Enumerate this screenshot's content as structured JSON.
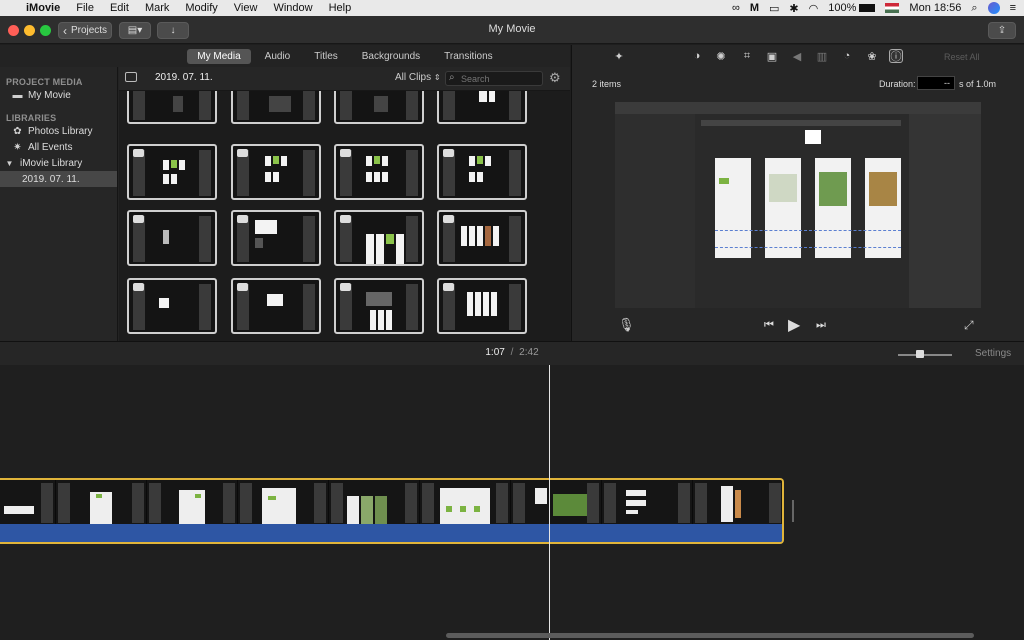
{
  "menubar": {
    "app_name": "iMovie",
    "items": [
      "File",
      "Edit",
      "Mark",
      "Modify",
      "View",
      "Window",
      "Help"
    ],
    "battery": "100%",
    "clock": "Mon 18:56"
  },
  "window": {
    "title": "My Movie",
    "projects_button": "Projects",
    "back_chevron": "‹",
    "close_color": "#ff5f57",
    "minimize_color": "#febc2e",
    "zoom_color": "#28c840"
  },
  "browser_tabs": {
    "tabs": [
      "My Media",
      "Audio",
      "Titles",
      "Backgrounds",
      "Transitions"
    ],
    "active": "My Media"
  },
  "sidebar": {
    "project_media_header": "PROJECT MEDIA",
    "my_movie": "My Movie",
    "libraries_header": "LIBRARIES",
    "photos_library": "Photos Library",
    "all_events": "All Events",
    "imovie_library": "iMovie Library",
    "event_date": "2019. 07. 11."
  },
  "media_header": {
    "event_label": "2019. 07. 11.",
    "filter": "All Clips",
    "search_placeholder": "Search"
  },
  "viewer": {
    "reset_all": "Reset All",
    "items_count": "2 items",
    "duration_label": "Duration:",
    "duration_value": "--",
    "duration_suffix": "s of 1.0m"
  },
  "timeline": {
    "current_time": "1:07",
    "separator": "/",
    "total_time": "2:42",
    "settings_label": "Settings",
    "clip_border_color": "#e0b43a",
    "audio_color": "#2e56a4"
  }
}
